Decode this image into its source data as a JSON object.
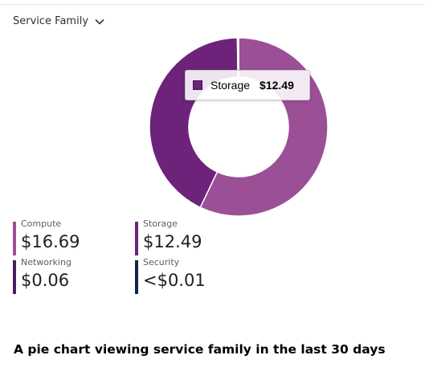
{
  "dropdown": {
    "label": "Service Family",
    "icon": "chevron-down-icon"
  },
  "tooltip": {
    "label": "Storage",
    "value": "$12.49",
    "color": "#6c2379"
  },
  "legend": [
    {
      "label": "Compute",
      "value": "$16.69",
      "color": "#9b4f96"
    },
    {
      "label": "Storage",
      "value": "$12.49",
      "color": "#6c2379"
    },
    {
      "label": "Networking",
      "value": "$0.06",
      "color": "#4a1f5c"
    },
    {
      "label": "Security",
      "value": "<$0.01",
      "color": "#0f2847"
    }
  ],
  "caption": "A pie chart viewing service family in the last 30 days",
  "chart_data": {
    "type": "pie",
    "donut": true,
    "title": "",
    "categories": [
      "Compute",
      "Storage",
      "Networking",
      "Security"
    ],
    "values": [
      16.69,
      12.49,
      0.06,
      0.005
    ],
    "colors": [
      "#9b4f96",
      "#6c2379",
      "#4a1f5c",
      "#0f2847"
    ],
    "legend_position": "bottom"
  }
}
